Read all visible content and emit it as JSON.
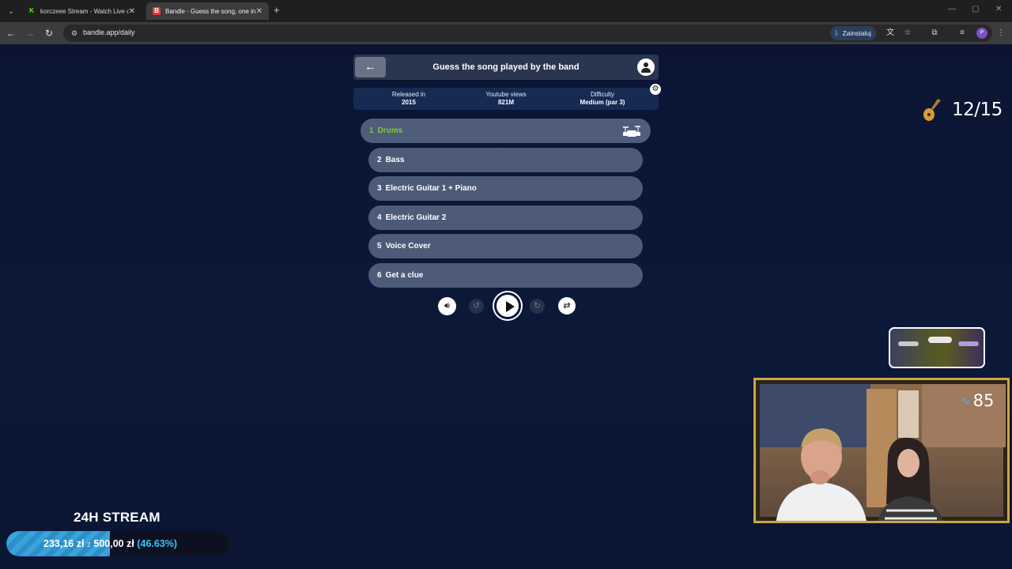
{
  "browser": {
    "tabs": [
      {
        "title": "korczeee Stream - Watch Live o",
        "favicon": "kick-logo-icon",
        "active": false
      },
      {
        "title": "Bandle - Guess the song, one in",
        "favicon": "bandle-icon",
        "active": true
      }
    ],
    "url": "bandle.app/daily",
    "install_label": "Zainstaluj",
    "profile_initial": "P"
  },
  "game": {
    "title": "Guess the song played by the band",
    "info": [
      {
        "label": "Released in",
        "value": "2015"
      },
      {
        "label": "Youtube views",
        "value": "821M"
      },
      {
        "label": "Difficulty",
        "value": "Medium (par 3)"
      }
    ],
    "tracks": [
      {
        "num": "1",
        "label": "Drums",
        "active": true
      },
      {
        "num": "2",
        "label": "Bass"
      },
      {
        "num": "3",
        "label": "Electric Guitar 1 + Piano"
      },
      {
        "num": "4",
        "label": "Electric Guitar 2"
      },
      {
        "num": "5",
        "label": "Voice Cover"
      },
      {
        "num": "6",
        "label": "Get a clue"
      }
    ],
    "skip_seconds": "5",
    "active_color": "#7ecb3f"
  },
  "overlay": {
    "counter": "12/15",
    "heart_rate": "85",
    "stream_title": "24H STREAM",
    "goal": {
      "current": "233,16 zł",
      "separator": "z",
      "target": "500,00 zł",
      "percent_text": "(46.63%)",
      "fraction": 0.4663
    }
  }
}
